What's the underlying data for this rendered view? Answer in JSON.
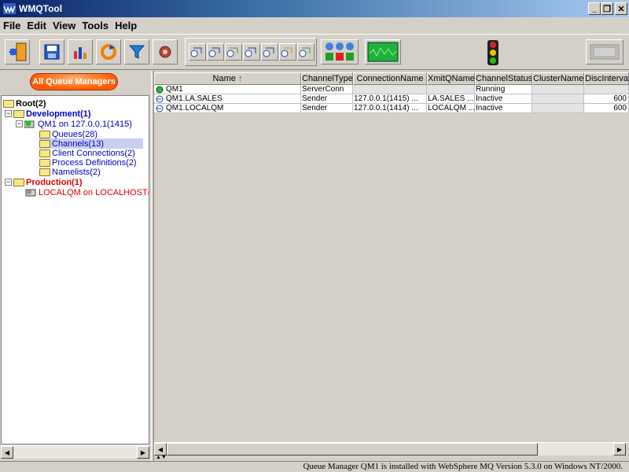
{
  "window": {
    "title": "WMQTool"
  },
  "menu": [
    "File",
    "Edit",
    "View",
    "Tools",
    "Help"
  ],
  "left": {
    "all_qm_label": "All Queue Managers",
    "tree": {
      "root": "Root(2)",
      "development": "Development(1)",
      "qm1": "QM1  on 127.0.0.1(1415)",
      "queues": "Queues(28)",
      "channels": "Channels(13)",
      "client_connections": "Client Connections(2)",
      "process_definitions": "Process Definitions(2)",
      "namelists": "Namelists(2)",
      "production": "Production(1)",
      "localqm": "LOCALQM on LOCALHOST("
    }
  },
  "table": {
    "sort_arrow": "↑",
    "columns": [
      "Name",
      "ChannelType",
      "ConnectionName",
      "XmitQName",
      "ChannelStatus",
      "ClusterName",
      "DiscInterva"
    ],
    "rows": [
      {
        "name": "QM1",
        "type": "ServerConn",
        "conn": "",
        "xmitq": "",
        "status": "Running",
        "cluster": "",
        "disc": ""
      },
      {
        "name": "QM1.LA.SALES",
        "type": "Sender",
        "conn": "127.0.0.1(1415)    ...",
        "xmitq": "LA.SALES  ...",
        "status": "Inactive",
        "cluster": "",
        "disc": "600"
      },
      {
        "name": "QM1.LOCALQM",
        "type": "Sender",
        "conn": "127.0.0.1(1414)    ...",
        "xmitq": "LOCALQM  ...",
        "status": "Inactive",
        "cluster": "",
        "disc": "600"
      }
    ]
  },
  "status": "Queue Manager QM1  is installed with WebSphere MQ Version 5.3.0 on Windows NT/2000.",
  "colors": {
    "dev": "#0000c0",
    "prod": "#e00000",
    "accent": "#ff6000"
  }
}
